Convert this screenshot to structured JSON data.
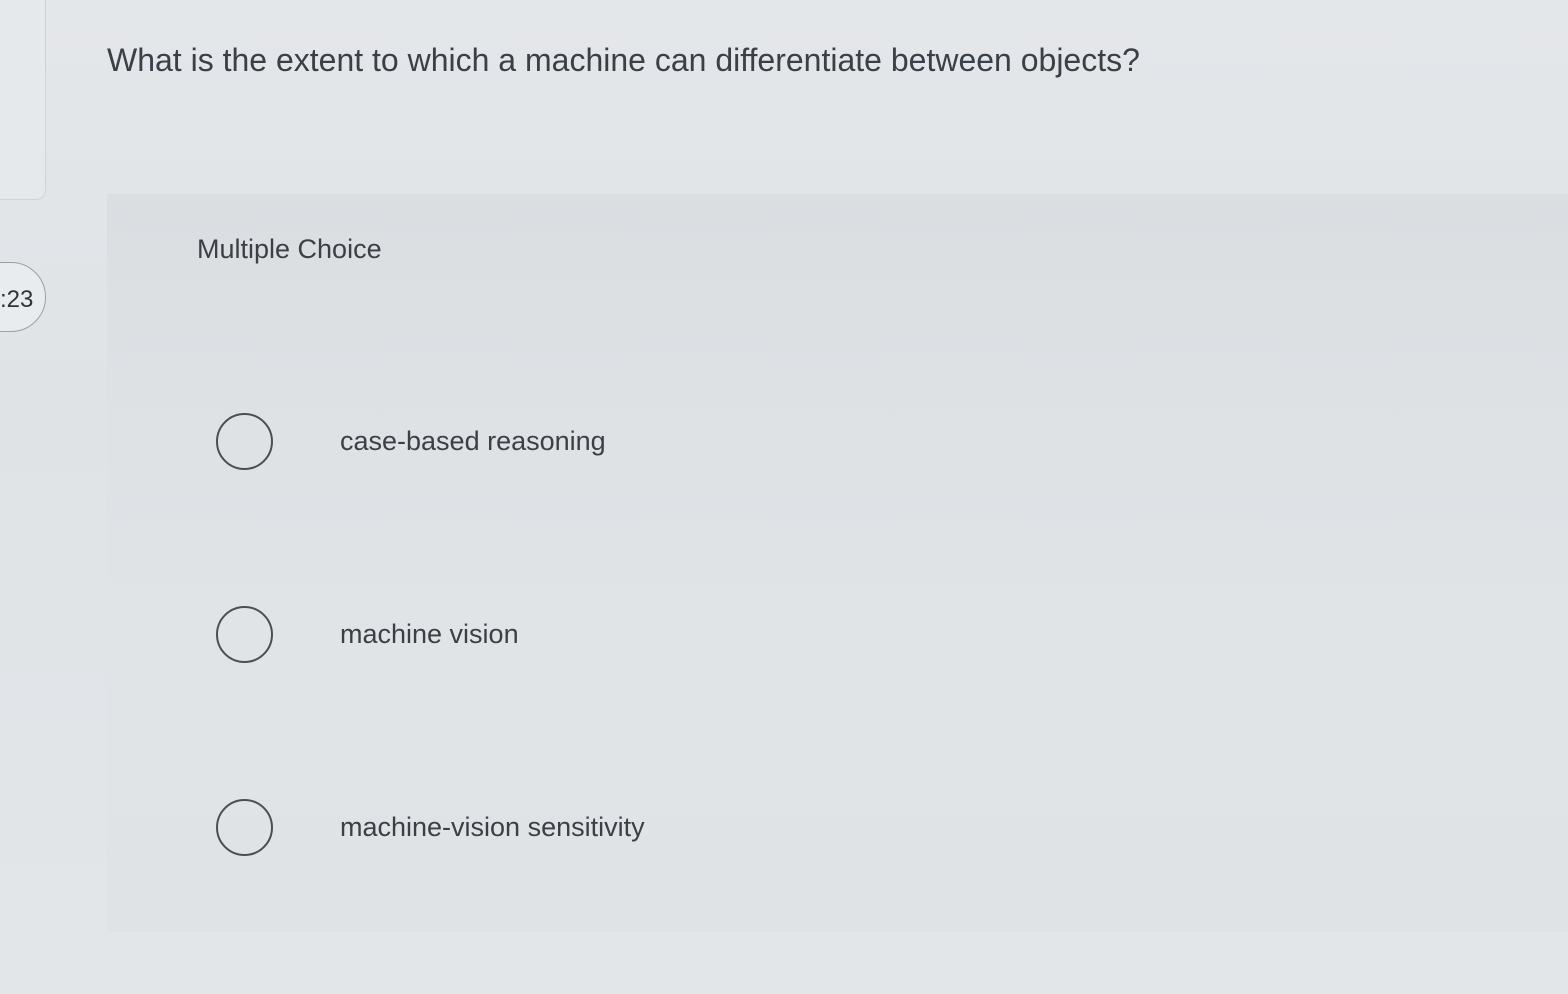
{
  "question": {
    "number": ":23",
    "text": "What is the extent to which a machine can differentiate between objects?"
  },
  "panel": {
    "label": "Multiple Choice"
  },
  "options": [
    {
      "label": "case-based reasoning",
      "selected": false
    },
    {
      "label": "machine vision",
      "selected": false
    },
    {
      "label": "machine-vision sensitivity",
      "selected": false
    }
  ]
}
